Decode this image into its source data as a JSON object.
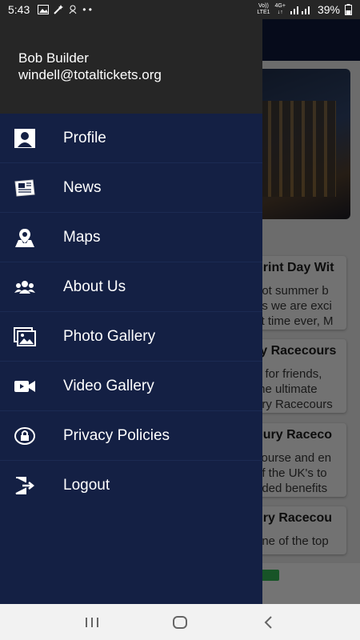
{
  "status_bar": {
    "time": "5:43",
    "network_top": "Vo))",
    "network_bottom": "LTE1",
    "network_type": "4G+",
    "battery": "39%"
  },
  "drawer": {
    "user_name": "Bob Builder",
    "user_email": "windell@totaltickets.org",
    "items": [
      {
        "label": "Profile",
        "icon": "profile-icon"
      },
      {
        "label": "News",
        "icon": "newspaper-icon"
      },
      {
        "label": "Maps",
        "icon": "map-pin-icon"
      },
      {
        "label": "About Us",
        "icon": "group-icon"
      },
      {
        "label": "Photo Gallery",
        "icon": "photo-gallery-icon"
      },
      {
        "label": "Video Gallery",
        "icon": "video-camera-icon"
      },
      {
        "label": "Privacy Policies",
        "icon": "lock-icon"
      },
      {
        "label": "Logout",
        "icon": "logout-icon"
      }
    ]
  },
  "background": {
    "cards": [
      {
        "title": "print Day Wit",
        "lines": [
          "hot summer b",
          "as we are exci",
          "st time ever, M"
        ]
      },
      {
        "title": "ry Racecours",
        "lines": [
          "e for friends,",
          "the ultimate",
          "ury Racecours"
        ]
      },
      {
        "title": "bury Raceco",
        "lines": [
          "course and en",
          "of the UK's to",
          "dded benefits"
        ]
      },
      {
        "title": "ury Racecou",
        "lines": [
          "one of the top"
        ]
      }
    ]
  },
  "colors": {
    "drawer_bg": "#142044",
    "header_bg": "#262626",
    "toolbar_bg": "#0d1736"
  }
}
